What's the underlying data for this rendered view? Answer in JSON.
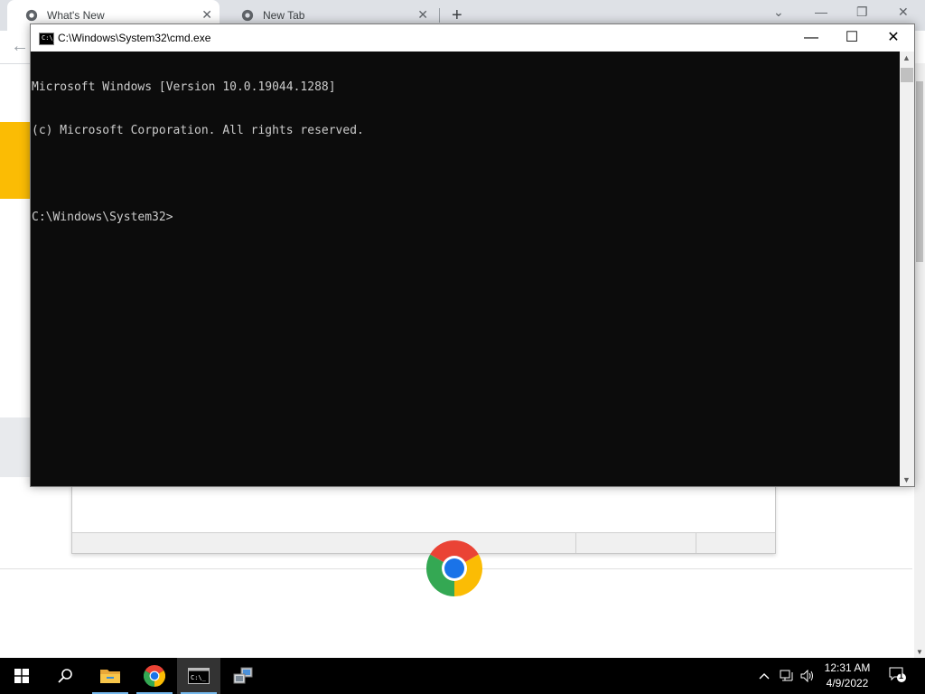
{
  "browser": {
    "tabs": [
      {
        "label": "What's New",
        "active": true
      },
      {
        "label": "New Tab",
        "active": false
      }
    ],
    "new_tab_symbol": "+",
    "close_symbol": "✕",
    "controls": {
      "dropdown": "⌄",
      "minimize": "—",
      "restore": "❐",
      "close": "✕"
    },
    "back_symbol": "←"
  },
  "cmd": {
    "title": "C:\\Windows\\System32\\cmd.exe",
    "icon_text": "C:\\_",
    "controls": {
      "minimize": "—",
      "maximize": "☐",
      "close": "✕"
    },
    "lines": [
      "Microsoft Windows [Version 10.0.19044.1288]",
      "(c) Microsoft Corporation. All rights reserved.",
      "",
      "C:\\Windows\\System32>"
    ]
  },
  "taskbar": {
    "items": [
      {
        "name": "start-button",
        "icon": "windows-logo-icon"
      },
      {
        "name": "search-button",
        "icon": "search-icon"
      },
      {
        "name": "file-explorer",
        "icon": "folder-icon",
        "running": true
      },
      {
        "name": "chrome",
        "icon": "chrome-icon",
        "running": true
      },
      {
        "name": "command-prompt",
        "icon": "cmd-icon",
        "running": true,
        "active": true
      },
      {
        "name": "network-app",
        "icon": "network-computer-icon"
      }
    ],
    "tray": {
      "chevron": "^",
      "volume": "🔊"
    },
    "clock": {
      "time": "12:31 AM",
      "date": "4/9/2022"
    },
    "notification_count": "1"
  },
  "colors": {
    "console_bg": "#0c0c0c",
    "console_text": "#cccccc",
    "taskbar_bg": "#000000",
    "chrome_tabstrip": "#dee1e6",
    "accent_yellow": "#fbbc04"
  }
}
